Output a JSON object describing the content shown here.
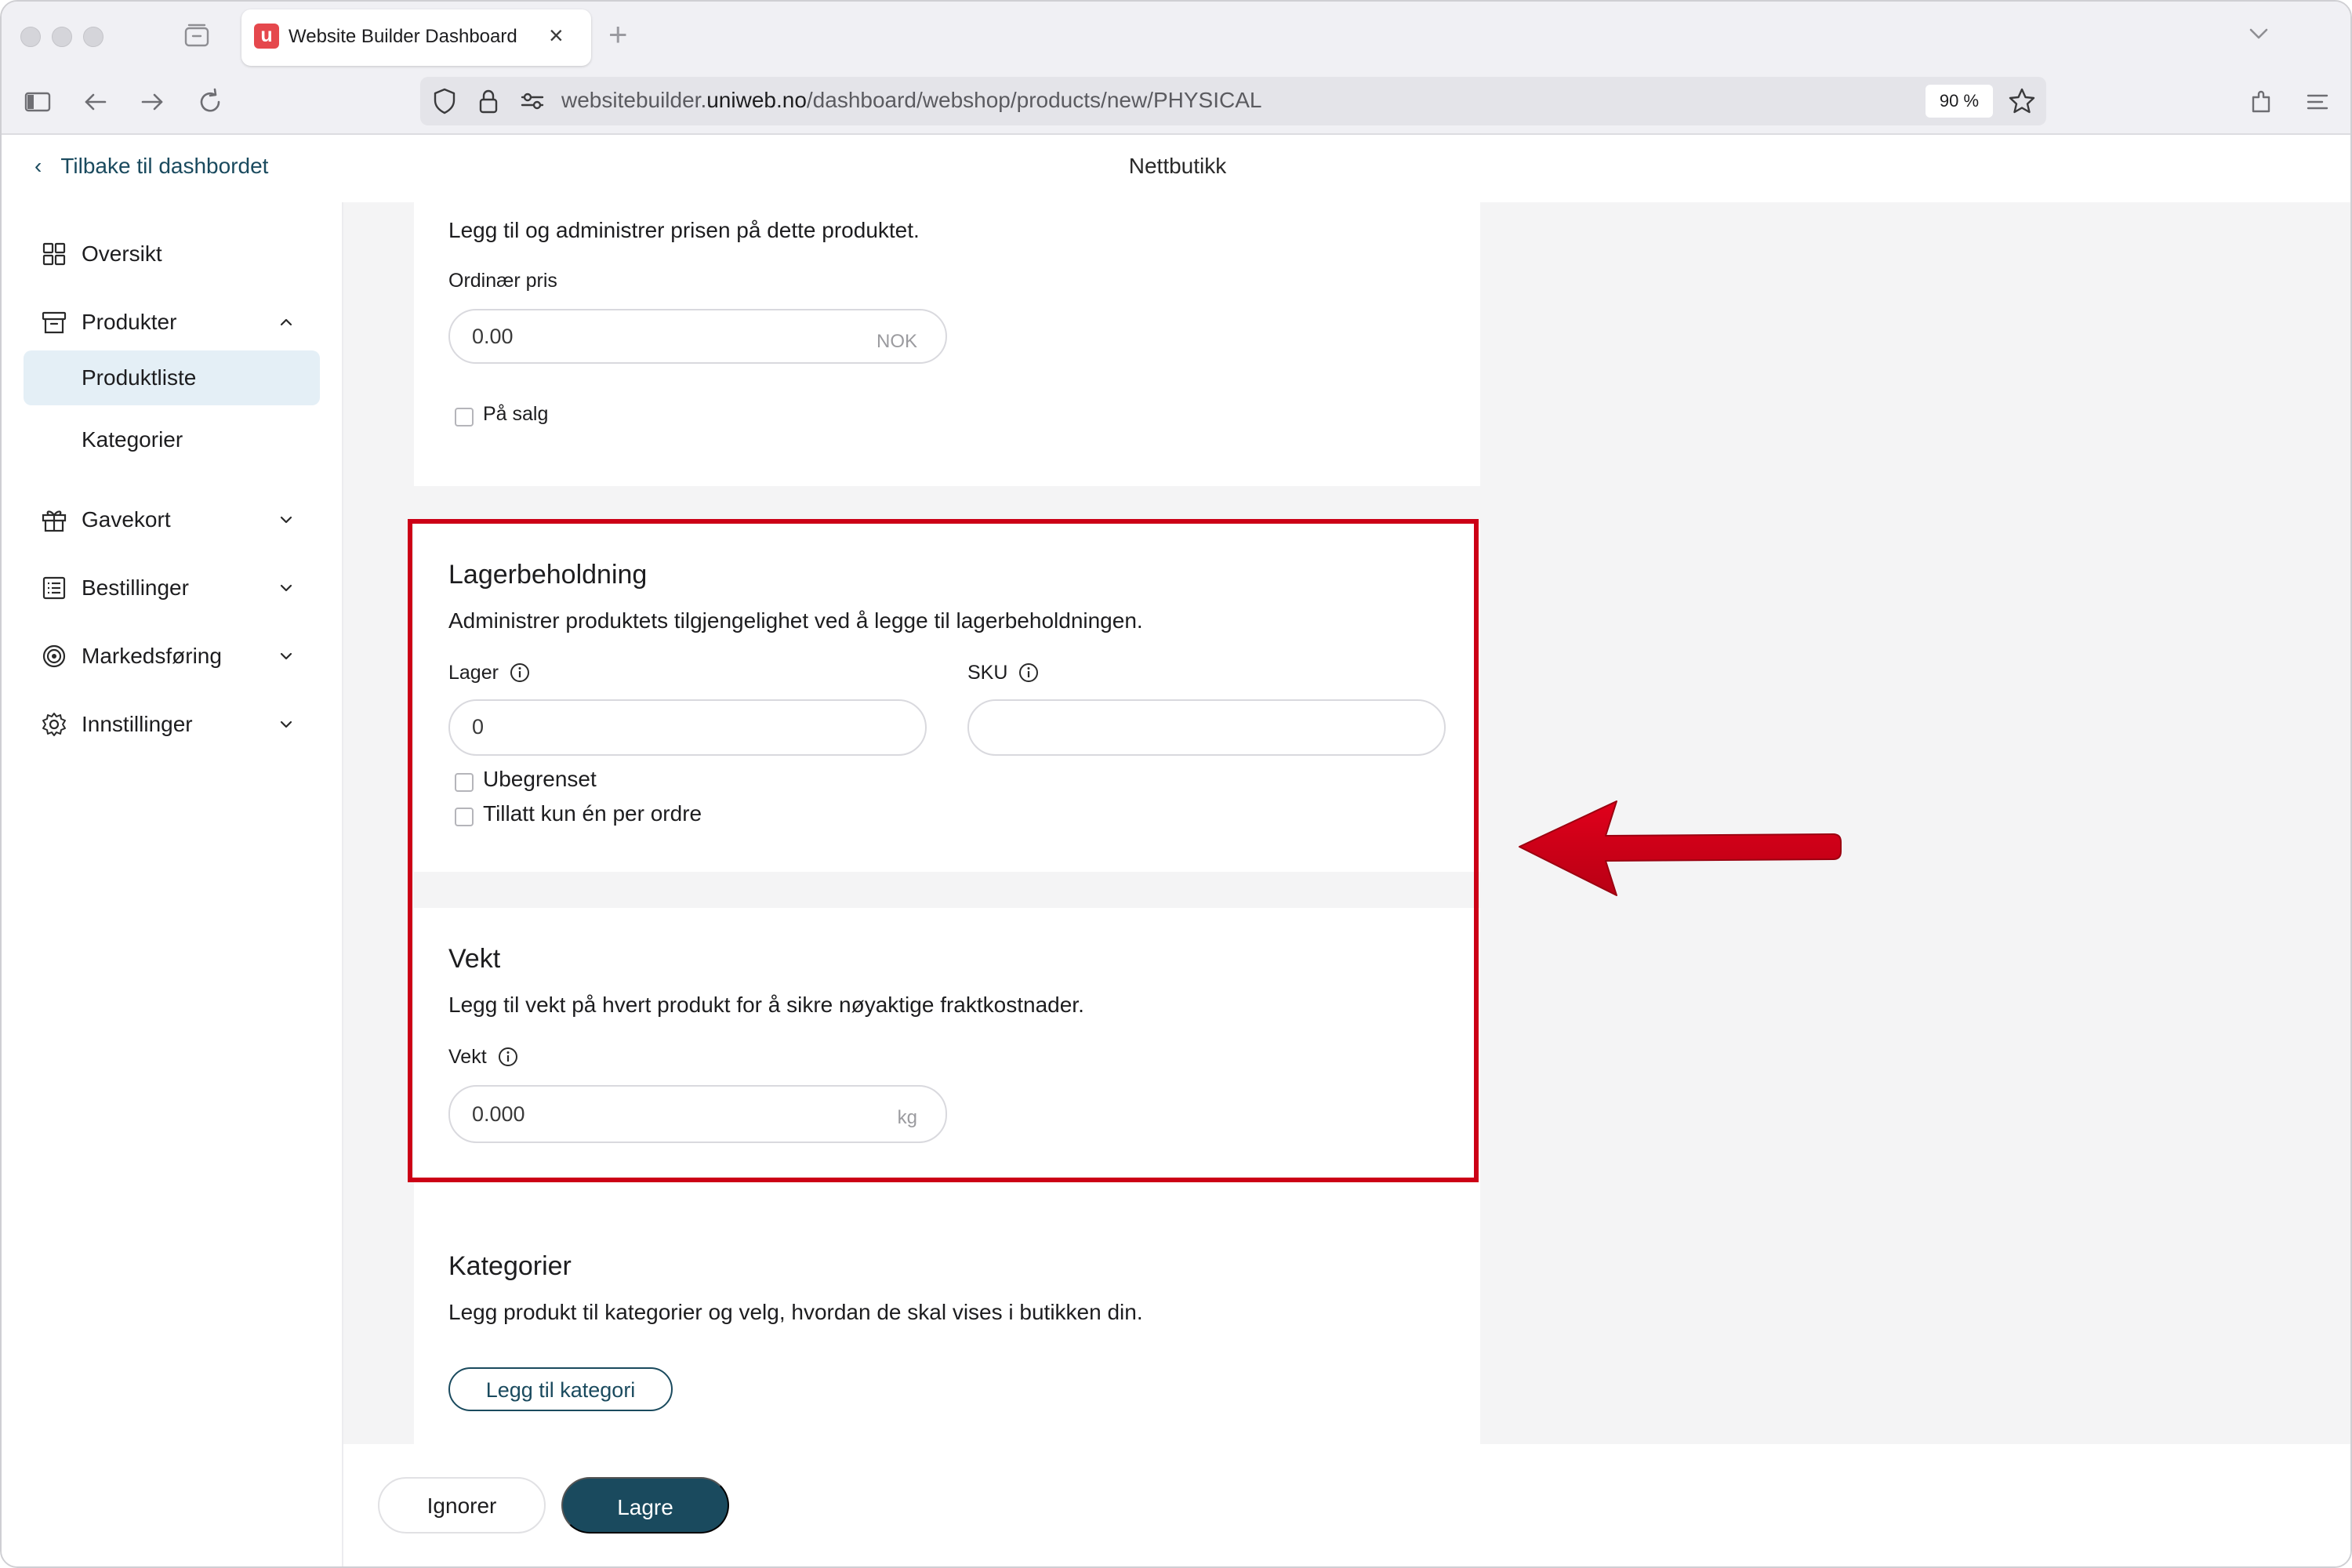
{
  "browser": {
    "tab_title": "Website Builder Dashboard",
    "tab_favicon_letter": "u",
    "url_prefix": "websitebuilder.",
    "url_domain": "uniweb.no",
    "url_path": "/dashboard/webshop/products/new/PHYSICAL",
    "zoom": "90 %"
  },
  "header": {
    "back_label": "Tilbake til dashbordet",
    "title": "Nettbutikk"
  },
  "sidebar": {
    "items": [
      {
        "label": "Oversikt",
        "icon": "grid-icon"
      },
      {
        "label": "Produkter",
        "icon": "archive-box-icon",
        "expanded": true
      },
      {
        "label": "Produktliste",
        "active": true
      },
      {
        "label": "Kategorier"
      },
      {
        "label": "Gavekort",
        "icon": "gift-icon"
      },
      {
        "label": "Bestillinger",
        "icon": "list-icon"
      },
      {
        "label": "Markedsføring",
        "icon": "target-icon"
      },
      {
        "label": "Innstillinger",
        "icon": "gear-icon"
      }
    ]
  },
  "price": {
    "description": "Legg til og administrer prisen på dette produktet.",
    "ordinary_price_label": "Ordinær pris",
    "ordinary_price_value": "0.00",
    "currency": "NOK",
    "on_sale_label": "På salg"
  },
  "inventory": {
    "title": "Lagerbeholdning",
    "description": "Administrer produktets tilgjengelighet ved å legge til lagerbeholdningen.",
    "stock_label": "Lager",
    "stock_value": "0",
    "sku_label": "SKU",
    "sku_value": "",
    "unlimited_label": "Ubegrenset",
    "one_per_order_label": "Tillatt kun én per ordre"
  },
  "weight": {
    "title": "Vekt",
    "description": "Legg til vekt på hvert produkt for å sikre nøyaktige fraktkostnader.",
    "weight_label": "Vekt",
    "weight_value": "0.000",
    "unit": "kg"
  },
  "categories": {
    "title": "Kategorier",
    "description": "Legg produkt til kategorier og velg, hvordan de skal vises i butikken din.",
    "add_button": "Legg til kategori"
  },
  "footer": {
    "ignore_label": "Ignorer",
    "save_label": "Lagre"
  },
  "colors": {
    "accent": "#1a4a5e",
    "highlight": "#cc0016",
    "active_bg": "#e4eff6"
  }
}
